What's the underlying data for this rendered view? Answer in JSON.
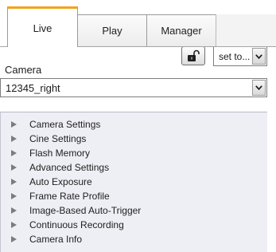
{
  "tabs": [
    {
      "label": "Live",
      "active": true
    },
    {
      "label": "Play",
      "active": false
    },
    {
      "label": "Manager",
      "active": false
    }
  ],
  "camera": {
    "label": "Camera",
    "selected": "12345_right",
    "set_to": "set to..."
  },
  "settings_tree": [
    "Camera Settings",
    "Cine Settings",
    "Flash Memory",
    "Advanced Settings",
    "Auto Exposure",
    "Frame Rate Profile",
    "Image-Based Auto-Trigger",
    "Continuous Recording",
    "Camera Info"
  ],
  "colors": {
    "active_tab_accent": "#f2a31b",
    "tree_background": "#eeeef5",
    "tree_arrow": "#7c7c7c"
  },
  "icons": {
    "lock": "padlock-icon",
    "dropdown": "chevron-down-icon",
    "tree_expand": "triangle-right-icon"
  }
}
